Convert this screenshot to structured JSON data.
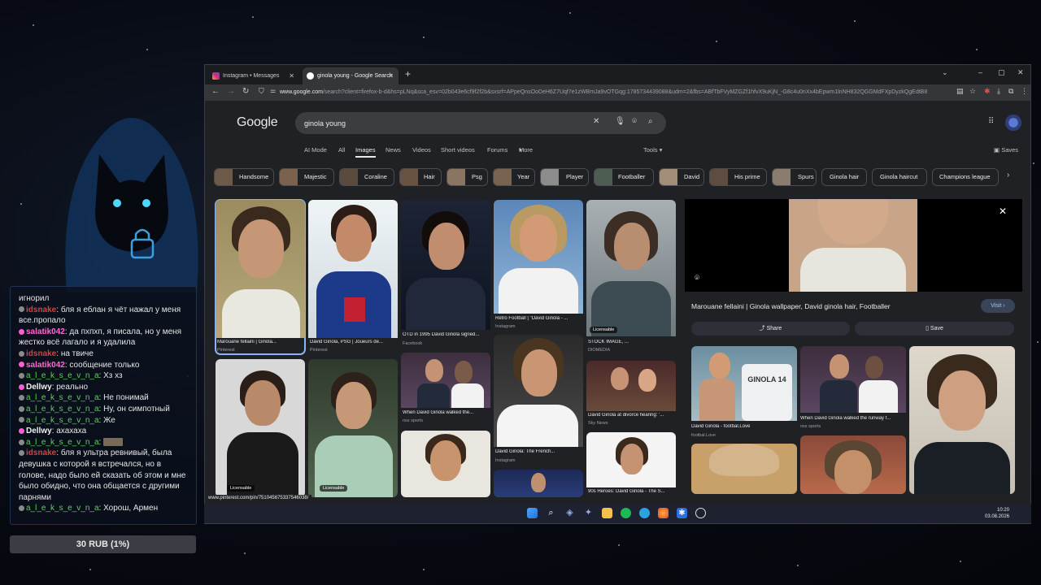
{
  "browser": {
    "tabs": [
      {
        "label": "Instagram • Messages",
        "active": false
      },
      {
        "label": "ginola young - Google Search",
        "active": true
      }
    ],
    "url_host": "www.google.com",
    "url_rest": "/search?client=firefox-b-d&hs=pLNq&sca_esv=02b043e6cf9f2f2b&sxsrf=APpeQnsOoDeH6Z7Uqf7e1zWBmJa9vOTGqg:1785734439088&udm=2&fbs=ABfTbFVyMZGZf1hfvX9uKjN_-G8c4u0nXx4bEpwm1lnNH832QGGMdFXpDyzkQgEdtB8"
  },
  "search": {
    "logo": "Google",
    "query": "ginola young",
    "nav_tabs": [
      "AI Mode",
      "All",
      "Images",
      "News",
      "Videos",
      "Short videos",
      "Forums",
      "More"
    ],
    "active_tab": "Images",
    "tools": "Tools",
    "saves": "Saves",
    "chips": [
      "Handsome",
      "Majestic",
      "Coraline",
      "Hair",
      "Psg",
      "Year",
      "Player",
      "Footballer",
      "David",
      "His prime",
      "Spurs",
      "Ginola hair",
      "Ginola haircut",
      "Champions league"
    ]
  },
  "results": [
    {
      "caption": "Marouane fellaini | Ginola...",
      "source": "Pinterest"
    },
    {
      "caption": "David Ginola, PSG | Joueurs de...",
      "source": "Pinterest"
    },
    {
      "caption": "OTD in 1995 David Ginola signed...",
      "source": "Facebook"
    },
    {
      "caption": "Retro Football | \"David Ginola - ...",
      "source": "Instagram"
    },
    {
      "caption": "STOCK IMAGE, ...",
      "source": "DIOMEDIA",
      "badge": "Licensable"
    },
    {
      "caption": "When David Ginola walked the...",
      "source": "nss sports"
    },
    {
      "caption": "David Ginola: The French...",
      "source": "Instagram"
    },
    {
      "caption": "David Ginola at divorce hearing: '...",
      "source": "Sky News"
    },
    {
      "caption": "90s Heroes: David Ginola - The S...",
      "source": ""
    }
  ],
  "badges": {
    "licensable": "Licensable"
  },
  "panel": {
    "title": "Marouane fellaini | Ginola wallpaper, David ginola hair, Footballer",
    "visit": "Visit",
    "share": "Share",
    "save": "Save",
    "related": [
      {
        "caption": "David Ginola - footbal.Love",
        "source": "footbal.Love",
        "shirt": "GINOLA 14"
      },
      {
        "caption": "When David Ginola walked the runway f...",
        "source": "nss sports"
      }
    ]
  },
  "status_url": "www.pinterest.com/pin/751045675337546038/",
  "clock": {
    "time": "10:20",
    "date": "03.08.2026"
  },
  "chat": [
    {
      "user": "",
      "text": "игнорил",
      "color": ""
    },
    {
      "user": "idsnake",
      "text": "бля я еблан я чёт нажал у меня все.пропало",
      "color": "red"
    },
    {
      "user": "salatik042",
      "text": "да пхпхп, я писала, но у меня жестко всё лагало и я удалила",
      "color": "pink"
    },
    {
      "user": "idsnake",
      "text": "на твиче",
      "color": "red"
    },
    {
      "user": "salatik042",
      "text": "сообщение только",
      "color": "pink"
    },
    {
      "user": "a_l_e_k_s_e_v_n_a",
      "text": "Хз хз",
      "color": "green"
    },
    {
      "user": "Dellwy",
      "text": "реально",
      "color": "white"
    },
    {
      "user": "a_l_e_k_s_e_v_n_a",
      "text": "Не понимай",
      "color": "green"
    },
    {
      "user": "a_l_e_k_s_e_v_n_a",
      "text": "Ну, он симпотный",
      "color": "green"
    },
    {
      "user": "a_l_e_k_s_e_v_n_a",
      "text": "Же",
      "color": "green"
    },
    {
      "user": "Dellwy",
      "text": "ахахаха",
      "color": "white"
    },
    {
      "user": "a_l_e_k_s_e_v_n_a",
      "text": "",
      "color": "green"
    },
    {
      "user": "idsnake",
      "text": "бля я ультра ревнивый, была девушка с которой я встречался, но в голове, надо было ей сказать об этом и мне было обидно, что она общается с другими парнями",
      "color": "red"
    },
    {
      "user": "a_l_e_k_s_e_v_n_a",
      "text": "Хорош, Армен",
      "color": "green"
    }
  ],
  "donation": "30 RUB (1%)"
}
